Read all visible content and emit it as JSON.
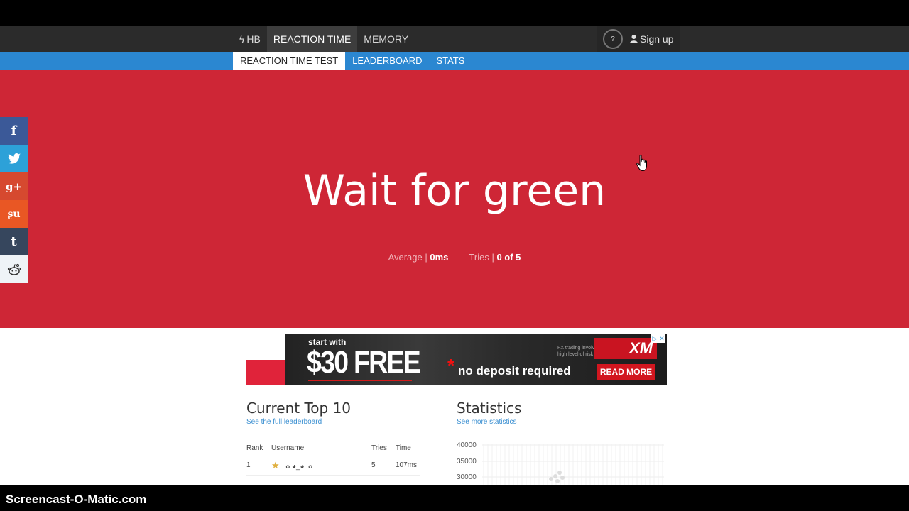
{
  "nav": {
    "brand": "HB",
    "items": [
      "REACTION TIME",
      "MEMORY"
    ],
    "help": "?",
    "signup": "Sign up"
  },
  "subnav": {
    "items": [
      "REACTION TIME TEST",
      "LEADERBOARD",
      "STATS"
    ]
  },
  "hero": {
    "title": "Wait for green",
    "average_label": "Average |",
    "average_value": "0ms",
    "tries_label": "Tries |",
    "tries_value": "0 of 5",
    "bg_color": "#ce2636"
  },
  "social": [
    "facebook-icon",
    "twitter-icon",
    "google-plus-icon",
    "stumbleupon-icon",
    "tumblr-icon",
    "reddit-icon"
  ],
  "ad": {
    "start": "start with",
    "big": "$30 FREE",
    "star": "*",
    "no_deposit": "no deposit required",
    "small_print": "FX trading involves a high level of risk",
    "logo": "XM",
    "logo_url": "WWW.XM.COM",
    "cta": "READ MORE"
  },
  "top10": {
    "title": "Current Top 10",
    "link": "See the full leaderboard",
    "headers": [
      "Rank",
      "Username",
      "Tries",
      "Time"
    ],
    "rows": [
      {
        "rank": "1",
        "username": "ᓄ ◕_◕ ᓄ",
        "tries": "5",
        "time": "107ms"
      }
    ]
  },
  "statistics": {
    "title": "Statistics",
    "link": "See more statistics"
  },
  "chart_data": {
    "type": "scatter",
    "yticks": [
      "40000",
      "35000",
      "30000"
    ]
  },
  "watermark": "Screencast-O-Matic.com"
}
